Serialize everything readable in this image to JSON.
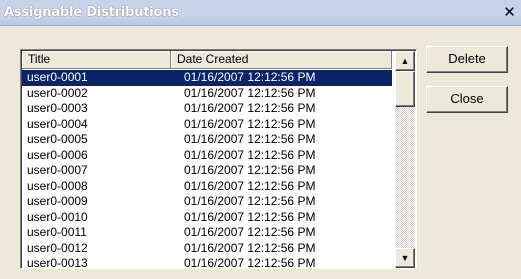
{
  "window": {
    "title": "Assignable Distributions",
    "close_glyph": "✕"
  },
  "list": {
    "columns": [
      "Title",
      "Date Created"
    ],
    "selected_index": 0,
    "rows": [
      {
        "title": "user0-0001",
        "date": "01/16/2007 12:12:56 PM"
      },
      {
        "title": "user0-0002",
        "date": "01/16/2007 12:12:56 PM"
      },
      {
        "title": "user0-0003",
        "date": "01/16/2007 12:12:56 PM"
      },
      {
        "title": "user0-0004",
        "date": "01/16/2007 12:12:56 PM"
      },
      {
        "title": "user0-0005",
        "date": "01/16/2007 12:12:56 PM"
      },
      {
        "title": "user0-0006",
        "date": "01/16/2007 12:12:56 PM"
      },
      {
        "title": "user0-0007",
        "date": "01/16/2007 12:12:56 PM"
      },
      {
        "title": "user0-0008",
        "date": "01/16/2007 12:12:56 PM"
      },
      {
        "title": "user0-0009",
        "date": "01/16/2007 12:12:56 PM"
      },
      {
        "title": "user0-0010",
        "date": "01/16/2007 12:12:56 PM"
      },
      {
        "title": "user0-0011",
        "date": "01/16/2007 12:12:56 PM"
      },
      {
        "title": "user0-0012",
        "date": "01/16/2007 12:12:56 PM"
      },
      {
        "title": "user0-0013",
        "date": "01/16/2007 12:12:56 PM"
      }
    ]
  },
  "buttons": {
    "delete_label": "Delete",
    "close_label": "Close"
  },
  "icons": {
    "scroll_up": "▲",
    "scroll_down": "▼"
  },
  "colors": {
    "selection": "#0a246a",
    "face": "#ece9d8"
  }
}
